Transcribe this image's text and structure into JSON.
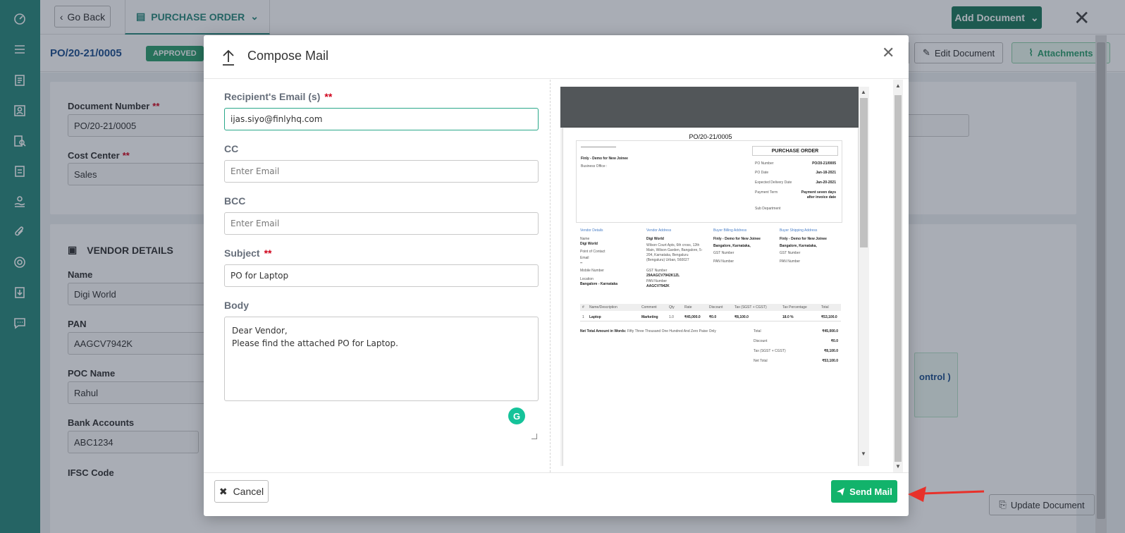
{
  "background": {
    "topbar": {
      "go_back_label": "Go Back",
      "tab_label": "PURCHASE ORDER",
      "add_document_label": "Add Document"
    },
    "subbar": {
      "po_number": "PO/20-21/0005",
      "status": "APPROVED",
      "edit_document_label": "Edit Document",
      "attachments_label": "Attachments"
    },
    "fields": {
      "document_number_label": "Document Number",
      "document_number_value": "PO/20-21/0005",
      "cost_center_label": "Cost Center",
      "cost_center_value": "Sales"
    },
    "vendor": {
      "section_title": "VENDOR DETAILS",
      "name_label": "Name",
      "name_value": "Digi World",
      "pan_label": "PAN",
      "pan_value": "AAGCV7942K",
      "poc_label": "POC Name",
      "poc_value": "Rahul",
      "bank_label": "Bank Accounts",
      "bank_value": "ABC1234",
      "ifsc_label": "IFSC Code"
    },
    "right_box_text": "ontrol )",
    "update_document_label": "Update Document"
  },
  "modal": {
    "title": "Compose Mail",
    "recipient_label": "Recipient's Email (s)",
    "required_mark": "**",
    "recipient_value": "ijas.siyo@finlyhq.com",
    "cc_label": "CC",
    "cc_placeholder": "Enter Email",
    "bcc_label": "BCC",
    "bcc_placeholder": "Enter Email",
    "subject_label": "Subject",
    "subject_value": "PO for Laptop",
    "body_label": "Body",
    "body_value": "Dear Vendor,\nPlease find the attached PO for Laptop.",
    "cancel_label": "Cancel",
    "send_label": "Send Mail"
  },
  "preview": {
    "doc_title": "PO/20-21/0005",
    "company": "Finly - Demo for New Joinee",
    "business_office": "Business Office :",
    "po_box_title": "PURCHASE ORDER",
    "meta": [
      {
        "label": "PO Number",
        "value": "PO/20-21/0005"
      },
      {
        "label": "PO Date",
        "value": "Jan-18-2021"
      },
      {
        "label": "Expected Delivery Date",
        "value": "Jan-20-2021"
      },
      {
        "label": "Payment Term",
        "value": "Payment seven days"
      },
      {
        "label": "",
        "value": "after invoice date"
      },
      {
        "label": "Sub Department",
        "value": ""
      }
    ],
    "section_headers": [
      "Vendor Details",
      "Vendor Address",
      "Buyer Billing Address",
      "Buyer Shipping Address"
    ],
    "vendor_details": [
      "Name",
      "Digi World",
      "Point of Contact",
      "Email",
      "--",
      "Mobile Number",
      "Location",
      "Bangalore - Karnataka"
    ],
    "vendor_address": [
      "Digi World",
      "Wilson Court Apts, 6th cross, 12th",
      "Main, Wilson Garden, Bangalore, 5-",
      "204, Karnataka, Bengaluru",
      "(Bengaluru) Urban, 560027",
      "",
      "GST Number",
      "29AAGCV7942K1ZL",
      "PAN Number",
      "AAGCV7942K"
    ],
    "billing": [
      "Finly - Demo for New Joinee",
      "Bangalore, Karnataka,",
      "GST Number",
      "PAN Number"
    ],
    "shipping": [
      "Finly - Demo for New Joinee",
      "Bangalore, Karnataka,",
      "GST Number",
      "PAN Number"
    ],
    "table_headers": [
      "#",
      "Name/Description",
      "Comment",
      "Qty",
      "Rate",
      "Discount",
      "Tax (SGST + CGST)",
      "Tax Percentage",
      "Total"
    ],
    "table_row": [
      "1",
      "Laptop",
      "Marketing",
      "1.0",
      "₹45,000.0",
      "₹0.0",
      "₹8,100.0",
      "18.0 %",
      "₹53,100.0"
    ],
    "words_label": "Net Total Amount in Words:",
    "words_value": "Fifty Three Thousand One Hundred And Zero Paise Only",
    "totals": [
      {
        "label": "Total",
        "value": "₹45,000.0"
      },
      {
        "label": "Discount",
        "value": "₹0.0"
      },
      {
        "label": "Tax (SGST + CGST)",
        "value": "₹8,100.0"
      },
      {
        "label": "Net Total",
        "value": "₹53,100.0"
      }
    ]
  },
  "colors": {
    "sidebar": "#2a8a7c",
    "send_button": "#12b36b",
    "add_document": "#1e7a5c",
    "focus_border": "#2aa88a",
    "required": "#d0021b",
    "arrow": "#e8312a"
  }
}
